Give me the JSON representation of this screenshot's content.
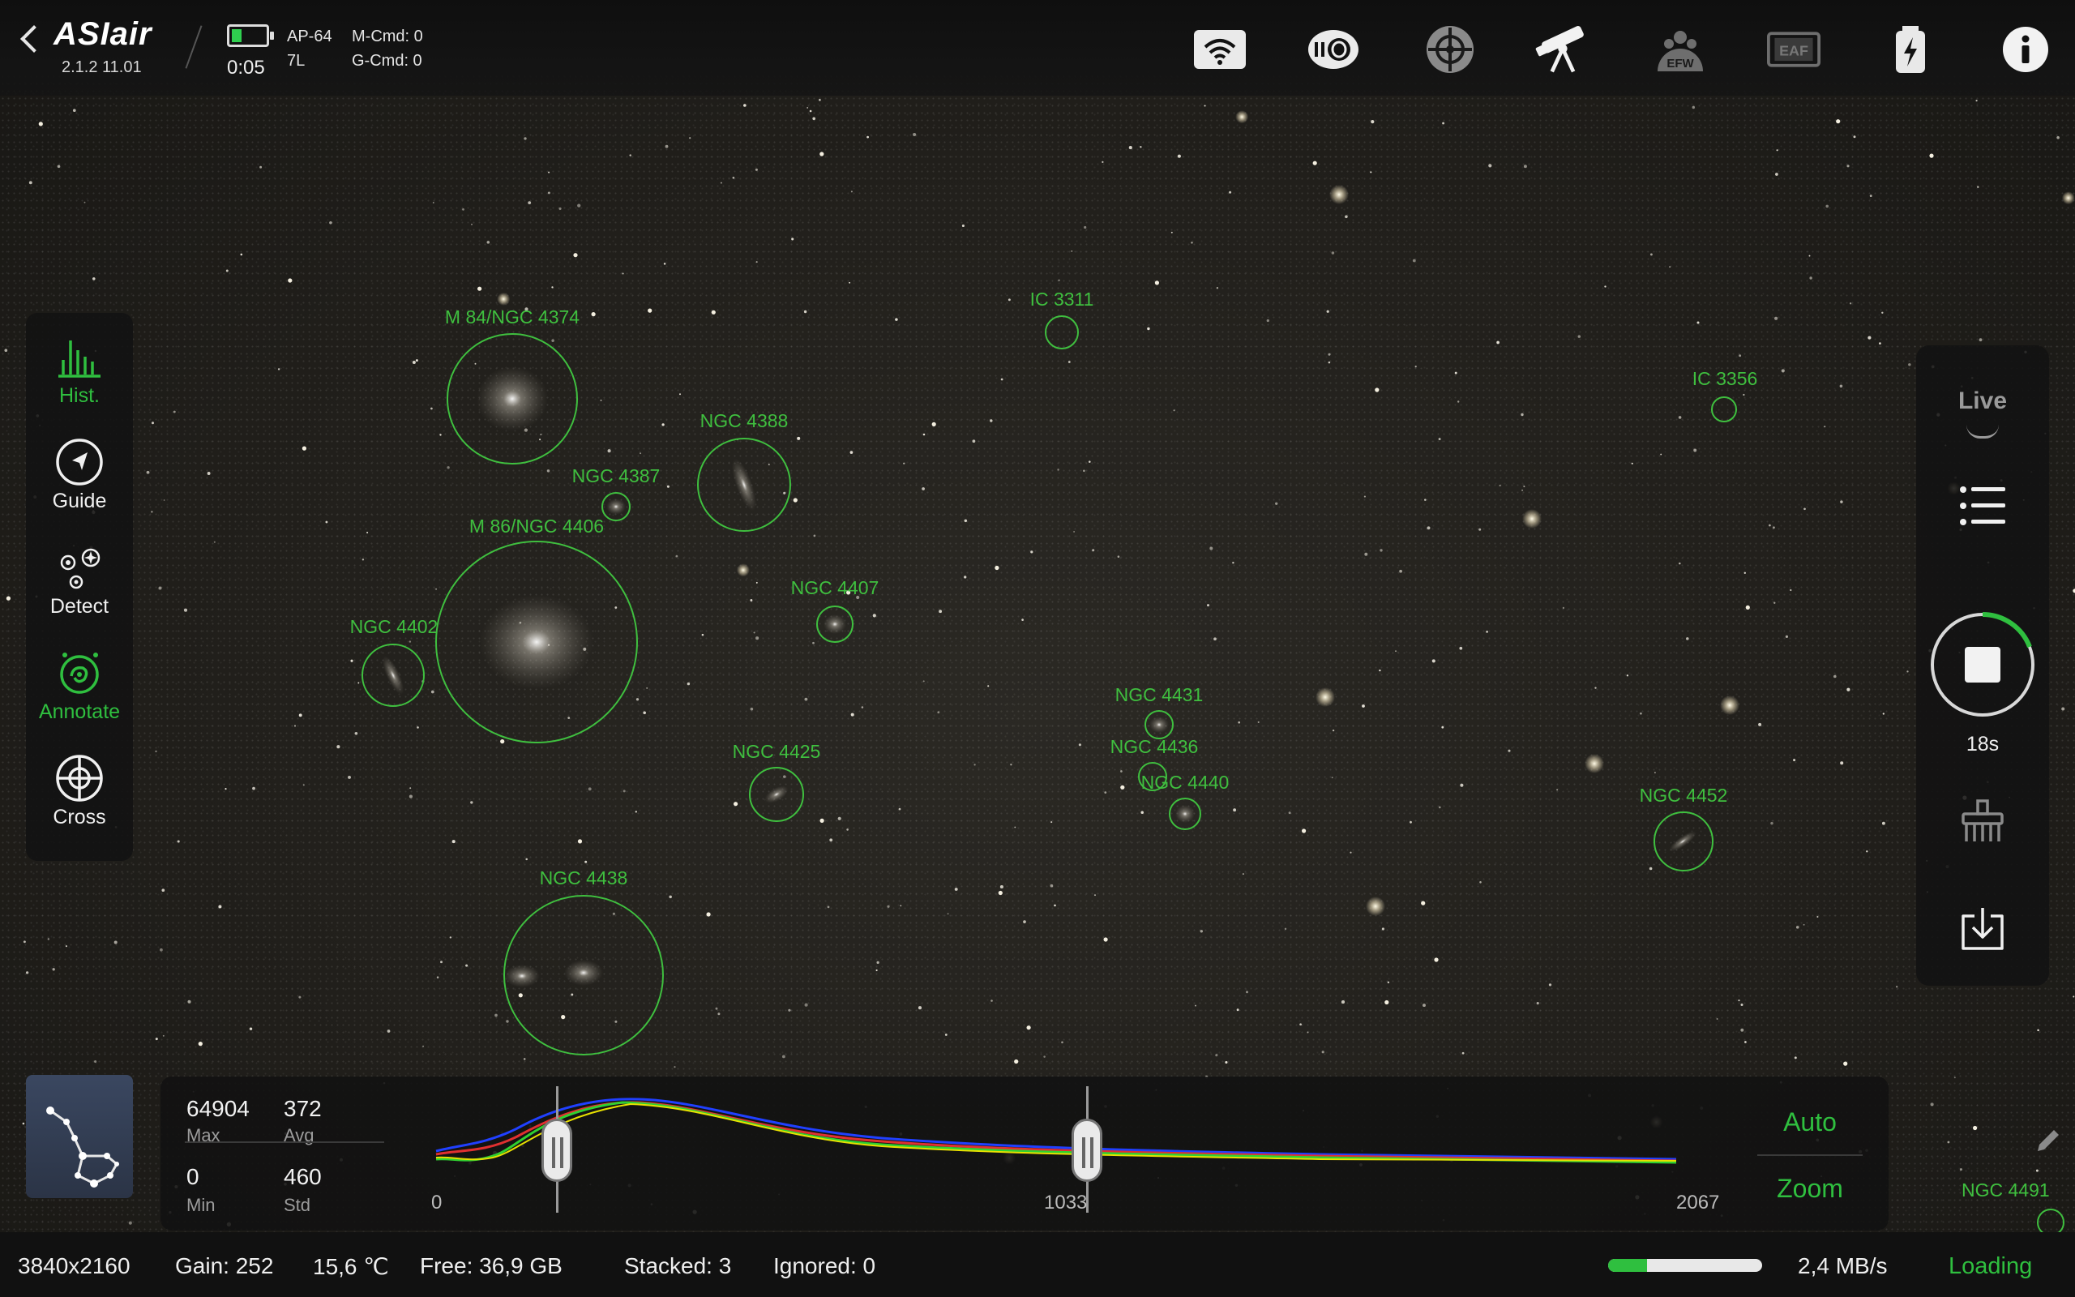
{
  "app": {
    "logo": "ASIair",
    "version": "2.1.2 11.01",
    "elapsed": "0:05",
    "device_model": "AP-64",
    "device_sub": "7L",
    "m_cmd": "M-Cmd: 0",
    "g_cmd": "G-Cmd: 0",
    "battery_level": 0.3
  },
  "top_icons": [
    {
      "name": "wifi-icon"
    },
    {
      "name": "camera-icon"
    },
    {
      "name": "guide-camera-icon"
    },
    {
      "name": "telescope-icon"
    },
    {
      "name": "efw-icon",
      "label": "EFW"
    },
    {
      "name": "eaf-icon",
      "label": "EAF"
    },
    {
      "name": "power-icon"
    },
    {
      "name": "info-icon"
    }
  ],
  "left_tools": [
    {
      "name": "hist",
      "label": "Hist.",
      "active": true
    },
    {
      "name": "guide",
      "label": "Guide",
      "active": false
    },
    {
      "name": "detect",
      "label": "Detect",
      "active": false
    },
    {
      "name": "annotate",
      "label": "Annotate",
      "active": true
    },
    {
      "name": "cross",
      "label": "Cross",
      "active": false
    }
  ],
  "right_panel": {
    "mode": "Live",
    "exposure_time": "18s",
    "accent": "#2fbf3f"
  },
  "annotations": [
    {
      "label": "M 84/NGC 4374"
    },
    {
      "label": "NGC 4387"
    },
    {
      "label": "NGC 4388"
    },
    {
      "label": "M 86/NGC 4406"
    },
    {
      "label": "NGC 4402"
    },
    {
      "label": "NGC 4407"
    },
    {
      "label": "IC 3311"
    },
    {
      "label": "IC 3356"
    },
    {
      "label": "NGC 4431"
    },
    {
      "label": "NGC 4436"
    },
    {
      "label": "NGC 4440"
    },
    {
      "label": "NGC 4425"
    },
    {
      "label": "NGC 4438"
    },
    {
      "label": "NGC 4452"
    },
    {
      "label": "NGC 4491"
    }
  ],
  "histogram": {
    "max_value": "64904",
    "max_label": "Max",
    "avg_value": "372",
    "avg_label": "Avg",
    "min_value": "0",
    "min_label": "Min",
    "std_value": "460",
    "std_label": "Std",
    "axis_min": "0",
    "axis_mid": "1033",
    "axis_max": "2067",
    "auto_label": "Auto",
    "zoom_label": "Zoom"
  },
  "status": {
    "resolution": "3840x2160",
    "gain": "Gain: 252",
    "temperature": "15,6 ℃",
    "free": "Free: 36,9 GB",
    "stacked": "Stacked: 3",
    "ignored": "Ignored: 0",
    "progress": 0.25,
    "speed": "2,4 MB/s",
    "loading": "Loading"
  },
  "colors": {
    "accent": "#2fbf3f",
    "annotation": "#3fbf3f"
  }
}
